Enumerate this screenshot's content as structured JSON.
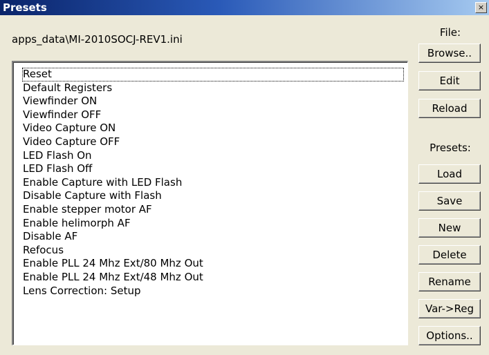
{
  "window": {
    "title": "Presets",
    "close_glyph": "×"
  },
  "file_path": "apps_data\\MI-2010SOCJ-REV1.ini",
  "file_section": {
    "label": "File:",
    "browse": "Browse..",
    "edit": "Edit",
    "reload": "Reload"
  },
  "presets_section": {
    "label": "Presets:",
    "load": "Load",
    "save": "Save",
    "new": "New",
    "delete": "Delete",
    "rename": "Rename",
    "var_reg": "Var->Reg",
    "options": "Options.."
  },
  "preset_list": {
    "selected_index": 0,
    "items": [
      "Reset",
      "Default Registers",
      "Viewfinder ON",
      "Viewfinder OFF",
      "Video Capture ON",
      "Video Capture OFF",
      "LED Flash On",
      "LED Flash Off",
      "Enable Capture with LED Flash",
      "Disable Capture with Flash",
      "Enable stepper motor AF",
      "Enable helimorph AF",
      "Disable AF",
      "Refocus",
      "Enable PLL 24 Mhz Ext/80 Mhz Out",
      "Enable PLL 24 Mhz Ext/48 Mhz Out",
      "Lens Correction: Setup"
    ]
  }
}
